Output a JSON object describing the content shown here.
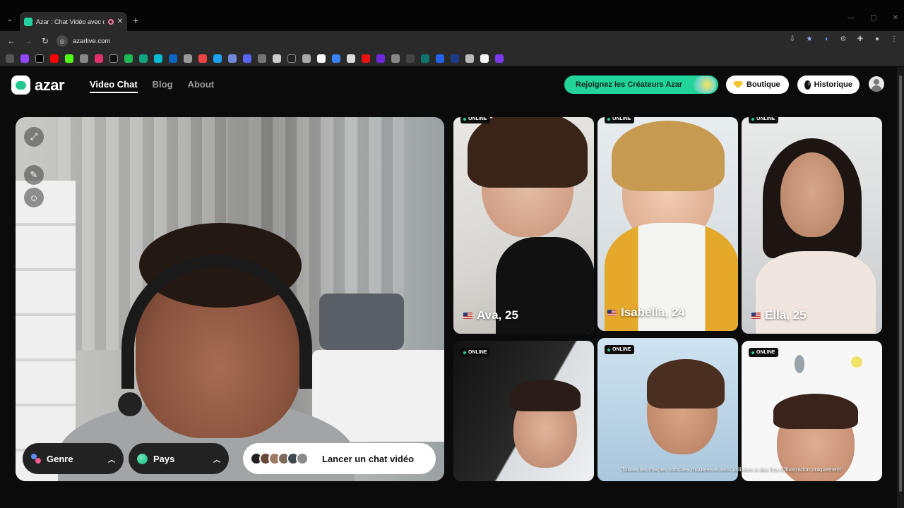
{
  "browser": {
    "tab_title": "Azar : Chat Vidéo avec de n",
    "url": "azarlive.com",
    "new_tab_icon": "+",
    "close_icon": "✕"
  },
  "site": {
    "logo_text": "azar",
    "nav": [
      {
        "label": "Video Chat",
        "active": true
      },
      {
        "label": "Blog",
        "active": false
      },
      {
        "label": "About",
        "active": false
      }
    ],
    "creators_button": "Rejoignez les Créateurs Azar",
    "shop_button": "Boutique",
    "history_button": "Historique"
  },
  "video": {
    "genre_label": "Genre",
    "country_label": "Pays",
    "launch_label": "Lancer un chat vidéo"
  },
  "gallery": {
    "online_label": "ONLINE",
    "cards": [
      {
        "label": "Ava, 25",
        "online": true
      },
      {
        "label": "Isabella, 24",
        "online": true
      },
      {
        "label": "Ella, 25",
        "online": true
      },
      {
        "label": "",
        "online": true
      },
      {
        "label": "",
        "online": true
      },
      {
        "label": "",
        "online": true
      }
    ],
    "disclaimer": "Toutes les images sont des modèles et sont utilisées à des fins d'illustration uniquement"
  },
  "colors": {
    "brand_green": "#22d39a",
    "page_bg": "#0b0b0b"
  }
}
